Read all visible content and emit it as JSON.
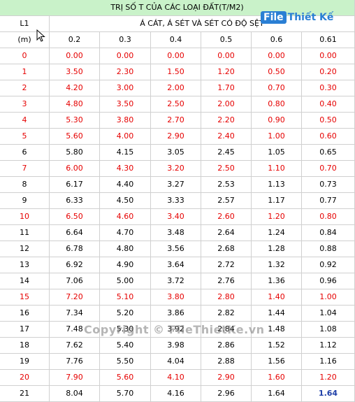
{
  "header": {
    "title": "TRỊ SỐ T CỦA CÁC LOẠI ĐẤT(T/M2)",
    "l1_label": "L1",
    "unit_label": "(m)",
    "subtitle": "Á CÁT, Á SÉT VÀ SÉT CÓ ĐỘ SỆT",
    "columns": [
      "0.2",
      "0.3",
      "0.4",
      "0.5",
      "0.6",
      "0.61"
    ]
  },
  "watermark": {
    "logo_box": "File",
    "logo_text": "Thiết Kế",
    "copyright": "Copyright © FileThietKe.vn"
  },
  "rows": [
    {
      "l": "0",
      "v": [
        "0.00",
        "0.00",
        "0.00",
        "0.00",
        "0.00",
        "0.00"
      ],
      "style": "red"
    },
    {
      "l": "1",
      "v": [
        "3.50",
        "2.30",
        "1.50",
        "1.20",
        "0.50",
        "0.20"
      ],
      "style": "red"
    },
    {
      "l": "2",
      "v": [
        "4.20",
        "3.00",
        "2.00",
        "1.70",
        "0.70",
        "0.30"
      ],
      "style": "red"
    },
    {
      "l": "3",
      "v": [
        "4.80",
        "3.50",
        "2.50",
        "2.00",
        "0.80",
        "0.40"
      ],
      "style": "red"
    },
    {
      "l": "4",
      "v": [
        "5.30",
        "3.80",
        "2.70",
        "2.20",
        "0.90",
        "0.50"
      ],
      "style": "red"
    },
    {
      "l": "5",
      "v": [
        "5.60",
        "4.00",
        "2.90",
        "2.40",
        "1.00",
        "0.60"
      ],
      "style": "red"
    },
    {
      "l": "6",
      "v": [
        "5.80",
        "4.15",
        "3.05",
        "2.45",
        "1.05",
        "0.65"
      ],
      "style": "black"
    },
    {
      "l": "7",
      "v": [
        "6.00",
        "4.30",
        "3.20",
        "2.50",
        "1.10",
        "0.70"
      ],
      "style": "red"
    },
    {
      "l": "8",
      "v": [
        "6.17",
        "4.40",
        "3.27",
        "2.53",
        "1.13",
        "0.73"
      ],
      "style": "black"
    },
    {
      "l": "9",
      "v": [
        "6.33",
        "4.50",
        "3.33",
        "2.57",
        "1.17",
        "0.77"
      ],
      "style": "black"
    },
    {
      "l": "10",
      "v": [
        "6.50",
        "4.60",
        "3.40",
        "2.60",
        "1.20",
        "0.80"
      ],
      "style": "red"
    },
    {
      "l": "11",
      "v": [
        "6.64",
        "4.70",
        "3.48",
        "2.64",
        "1.24",
        "0.84"
      ],
      "style": "black"
    },
    {
      "l": "12",
      "v": [
        "6.78",
        "4.80",
        "3.56",
        "2.68",
        "1.28",
        "0.88"
      ],
      "style": "black"
    },
    {
      "l": "13",
      "v": [
        "6.92",
        "4.90",
        "3.64",
        "2.72",
        "1.32",
        "0.92"
      ],
      "style": "black"
    },
    {
      "l": "14",
      "v": [
        "7.06",
        "5.00",
        "3.72",
        "2.76",
        "1.36",
        "0.96"
      ],
      "style": "black"
    },
    {
      "l": "15",
      "v": [
        "7.20",
        "5.10",
        "3.80",
        "2.80",
        "1.40",
        "1.00"
      ],
      "style": "red"
    },
    {
      "l": "16",
      "v": [
        "7.34",
        "5.20",
        "3.86",
        "2.82",
        "1.44",
        "1.04"
      ],
      "style": "black"
    },
    {
      "l": "17",
      "v": [
        "7.48",
        "5.30",
        "3.92",
        "2.84",
        "1.48",
        "1.08"
      ],
      "style": "black"
    },
    {
      "l": "18",
      "v": [
        "7.62",
        "5.40",
        "3.98",
        "2.86",
        "1.52",
        "1.12"
      ],
      "style": "black"
    },
    {
      "l": "19",
      "v": [
        "7.76",
        "5.50",
        "4.04",
        "2.88",
        "1.56",
        "1.16"
      ],
      "style": "black"
    },
    {
      "l": "20",
      "v": [
        "7.90",
        "5.60",
        "4.10",
        "2.90",
        "1.60",
        "1.20"
      ],
      "style": "red"
    },
    {
      "l": "21",
      "v": [
        "8.04",
        "5.70",
        "4.16",
        "2.96",
        "1.64",
        "1.64"
      ],
      "style": "black",
      "last_style": "blue"
    }
  ]
}
